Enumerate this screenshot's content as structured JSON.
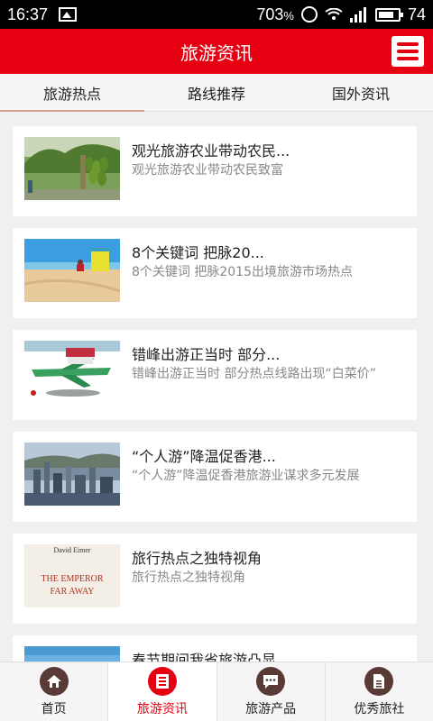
{
  "status_bar": {
    "time": "16:37",
    "data_speed": "703",
    "speed_unit": "%",
    "battery": "74"
  },
  "header": {
    "title": "旅游资讯"
  },
  "tabs": [
    {
      "label": "旅游热点",
      "active": true
    },
    {
      "label": "路线推荐",
      "active": false
    },
    {
      "label": "国外资讯",
      "active": false
    }
  ],
  "articles": [
    {
      "title": "观光旅游农业带动农民...",
      "desc": "观光旅游农业带动农民致富"
    },
    {
      "title": "8个关键词 把脉20...",
      "desc": "8个关键词 把脉2015出境旅游市场热点"
    },
    {
      "title": "错峰出游正当时 部分...",
      "desc": "错峰出游正当时 部分热点线路出现“白菜价”"
    },
    {
      "title": "“个人游”降温促香港...",
      "desc": "“个人游”降温促香港旅游业谋求多元发展"
    },
    {
      "title": "旅行热点之独特视角",
      "desc": "旅行热点之独特视角",
      "cover_author": "David Eimer",
      "cover_title": "THE EMPEROR FAR AWAY"
    },
    {
      "title": "春节期间我省旅游凸显",
      "desc": ""
    }
  ],
  "bottom_nav": [
    {
      "label": "首页",
      "icon": "home-icon",
      "active": false
    },
    {
      "label": "旅游资讯",
      "icon": "news-icon",
      "active": true
    },
    {
      "label": "旅游产品",
      "icon": "chat-icon",
      "active": false
    },
    {
      "label": "优秀旅社",
      "icon": "document-icon",
      "active": false
    }
  ],
  "colors": {
    "brand": "#e60012",
    "nav_icon": "#5a3a34"
  }
}
